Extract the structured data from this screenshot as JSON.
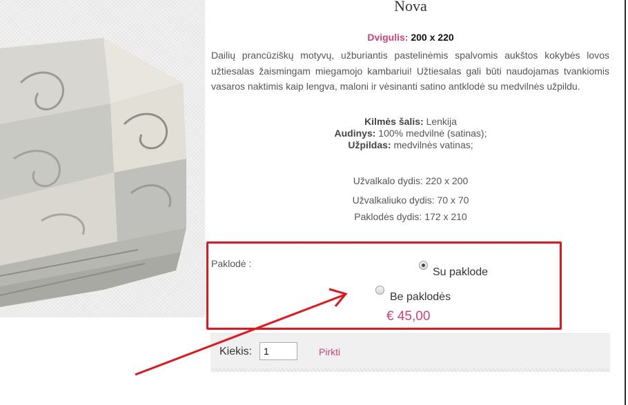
{
  "product": {
    "title": "Nova",
    "size_label": "Dvigulis:",
    "size_value": "200 x 220",
    "description": "Dailių prancūziškų motyvų, užburiantis pastelinėmis spalvomis aukštos kokybės lovos užtiesalas žaismingam miegamojo kambariui! Užtiesalas gali būti naudojamas tvankiomis vasaros naktimis kaip lengva, maloni ir vėsinanti satino antklodė su medvilnės užpildu."
  },
  "specs": [
    {
      "key": "Kilmės šalis:",
      "value": "Lenkija"
    },
    {
      "key": "Audinys:",
      "value": "100% medvilnė (satinas);"
    },
    {
      "key": "Užpildas:",
      "value": "medvilnės vatinas;"
    }
  ],
  "dims": [
    "Užvalkalo dydis: 220 x 200",
    "Užvalkaliuko dydis: 70 x 70",
    "Paklodės dydis: 172 x 210"
  ],
  "option": {
    "label": "Paklodė :",
    "choices": [
      {
        "label": "Su paklode",
        "selected": true
      },
      {
        "label": "Be paklodės",
        "selected": false
      }
    ],
    "price": "€ 45,00"
  },
  "cart": {
    "qty_label": "Kiekis:",
    "qty_value": "1",
    "buy_label": "Pirkti"
  },
  "colors": {
    "accent": "#d43f7a",
    "annotation": "#e8141a"
  }
}
